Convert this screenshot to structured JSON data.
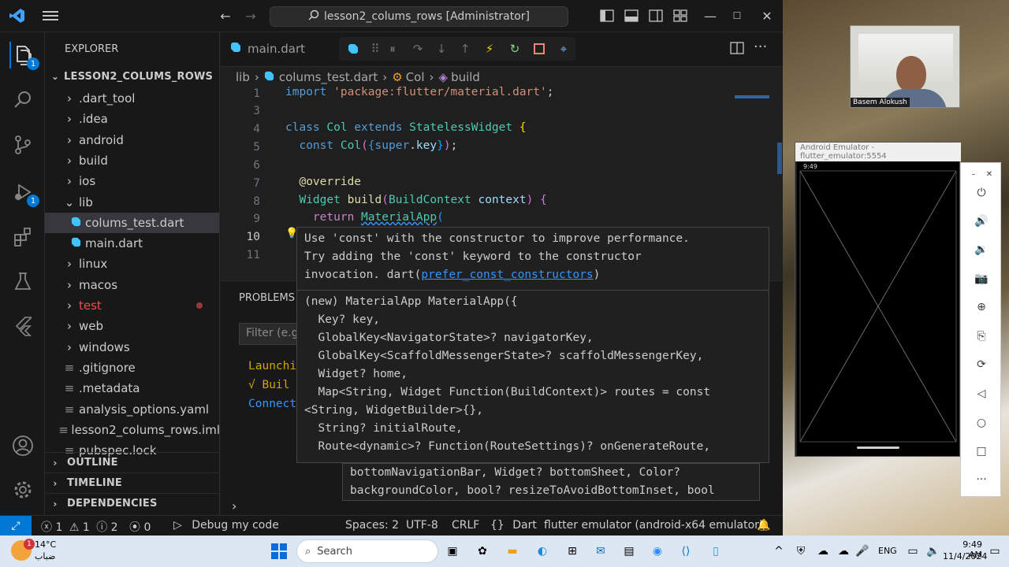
{
  "window": {
    "title": "lesson2_colums_rows [Administrator]"
  },
  "explorer": {
    "header": "EXPLORER",
    "root": "LESSON2_COLUMS_ROWS",
    "items": [
      {
        "label": ".dart_tool",
        "type": "folder"
      },
      {
        "label": ".idea",
        "type": "folder"
      },
      {
        "label": "android",
        "type": "folder"
      },
      {
        "label": "build",
        "type": "folder"
      },
      {
        "label": "ios",
        "type": "folder"
      },
      {
        "label": "lib",
        "type": "folder-open"
      },
      {
        "label": "colums_test.dart",
        "type": "dart-file"
      },
      {
        "label": "main.dart",
        "type": "dart-file"
      },
      {
        "label": "linux",
        "type": "folder"
      },
      {
        "label": "macos",
        "type": "folder"
      },
      {
        "label": "test",
        "type": "folder"
      },
      {
        "label": "web",
        "type": "folder"
      },
      {
        "label": "windows",
        "type": "folder"
      },
      {
        "label": ".gitignore",
        "type": "file"
      },
      {
        "label": ".metadata",
        "type": "file"
      },
      {
        "label": "analysis_options.yaml",
        "type": "file"
      },
      {
        "label": "lesson2_colums_rows.iml",
        "type": "file"
      },
      {
        "label": "pubspec.lock",
        "type": "file"
      }
    ],
    "outline": "OUTLINE",
    "timeline": "TIMELINE",
    "dependencies": "DEPENDENCIES"
  },
  "activity_badges": {
    "explorer": "1",
    "debug": "1"
  },
  "tab": {
    "label": "main.dart"
  },
  "breadcrumb": {
    "lib": "lib",
    "file": "colums_test.dart",
    "class": "Col",
    "method": "build"
  },
  "code": {
    "line_numbers": [
      "1",
      "3",
      "4",
      "5",
      "6",
      "7",
      "8",
      "9",
      "10",
      "11"
    ]
  },
  "panel": {
    "tab_label": "PROBLEMS",
    "filter_placeholder": "Filter (e.g.",
    "output_lines": [
      "Launchi",
      "√ Buil",
      "Connect"
    ]
  },
  "hover": {
    "lint_line1": "Use 'const' with the constructor to improve performance.",
    "lint_line2": "Try adding the 'const' keyword to the constructor",
    "lint_line3_prefix": "invocation. dart(",
    "lint_link": "prefer_const_constructors",
    "lint_line3_suffix": ")",
    "sig_lines": [
      "(new) MaterialApp MaterialApp({",
      "  Key? key,",
      "  GlobalKey<NavigatorState>? navigatorKey,",
      "  GlobalKey<ScaffoldMessengerState>? scaffoldMessengerKey,",
      "  Widget? home,",
      "  Map<String, Widget Function(BuildContext)> routes = const",
      "<String, WidgetBuilder>{},",
      "  String? initialRoute,",
      "  Route<dynamic>? Function(RouteSettings)? onGenerateRoute,"
    ],
    "extra_lines": [
      "bottomNavigationBar, Widget? bottomSheet, Color?",
      "backgroundColor, bool? resizeToAvoidBottomInset, bool"
    ]
  },
  "statusbar": {
    "errors": "1",
    "warnings": "1",
    "infos": "2",
    "ports": "0",
    "debug": "Debug my code",
    "spaces": "Spaces: 2",
    "encoding": "UTF-8",
    "eol": "CRLF",
    "language": "Dart",
    "device": "flutter emulator (android-x64 emulator)"
  },
  "webcam": {
    "name": "Basem Alokush"
  },
  "emulator": {
    "title": "Android Emulator - flutter_emulator:5554",
    "time": "9:49"
  },
  "taskbar": {
    "weather_temp": "14°C",
    "weather_desc": "ضباب",
    "weather_badge": "1",
    "search_placeholder": "Search",
    "lang": "ENG",
    "time": "9:49 AM",
    "date": "11/4/2024"
  },
  "colors": {
    "accent": "#0078d4",
    "editor_bg": "#1f1f1f",
    "sidebar_bg": "#181818"
  }
}
